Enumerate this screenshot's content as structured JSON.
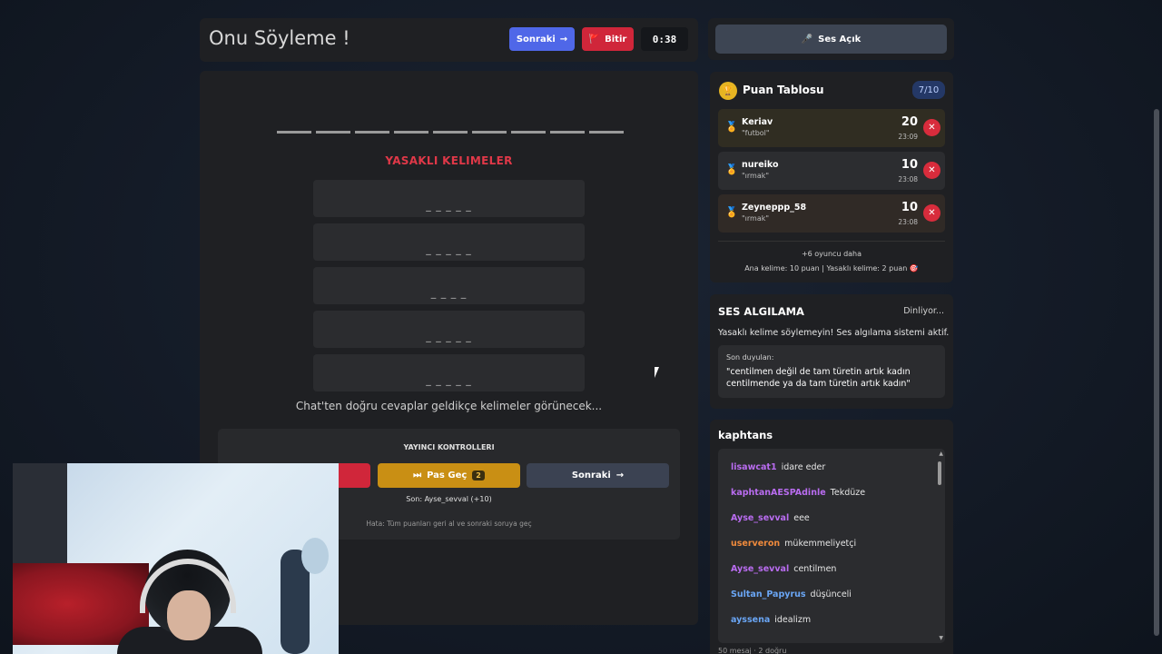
{
  "game": {
    "title": "Onu Söyleme !",
    "next_label": "Sonraki",
    "next_arrow": "→",
    "finish_label": "Bitir",
    "finish_icon": "🚩",
    "timer": "0:38"
  },
  "board": {
    "forbidden_title": "YASAKLI KELIMELER",
    "forbidden_words": [
      "_ _ _ _ _",
      "_ _ _ _ _",
      "_ _ _ _",
      "_ _ _ _ _",
      "_ _ _ _ _"
    ],
    "hint": "Chat'ten doğru cevaplar geldikçe kelimeler görünecek..."
  },
  "controls": {
    "title": "YAYINCI KONTROLLERI",
    "pass_label": "Pas Geç",
    "pass_icon": "⏭",
    "pass_count": "2",
    "next_label": "Sonraki",
    "next_arrow": "→",
    "last": "Son: Ayse_sevval (+10)",
    "error_hint": "Hata: Tüm puanları geri al ve sonraki soruya geç"
  },
  "sound": {
    "label": "Ses Açık",
    "icon": "🎤"
  },
  "scoreboard": {
    "title": "Puan Tablosu",
    "count": "7/10",
    "players": [
      {
        "name": "Keriav",
        "word": "\"futbol\"",
        "score": "20",
        "time": "23:09"
      },
      {
        "name": "nureiko",
        "word": "\"ırmak\"",
        "score": "10",
        "time": "23:08"
      },
      {
        "name": "Zeyneppp_58",
        "word": "\"ırmak\"",
        "score": "10",
        "time": "23:08"
      }
    ],
    "more": "+6 oyuncu daha",
    "points_info": "Ana kelime: 10 puan | Yasaklı kelime: 2 puan 🎯"
  },
  "voice": {
    "title": "SES ALGILAMA",
    "status": "Dinliyor...",
    "desc": "Yasaklı kelime söylemeyin! Ses algılama sistemi aktif.",
    "heard_label": "Son duyulan:",
    "heard_text": "\"centilmen değil de tam türetin artık kadın centilmende ya da tam türetin artık kadın\""
  },
  "chat": {
    "title": "kaphtans",
    "messages": [
      {
        "user": "lisawcat1",
        "text": "idare eder",
        "color": "#b96cf0"
      },
      {
        "user": "kaphtanAESPAdinle",
        "text": "Tekdüze",
        "color": "#b96cf0"
      },
      {
        "user": "Ayse_sevval",
        "text": "eee",
        "color": "#b96cf0"
      },
      {
        "user": "userveron",
        "text": "mükemmeliyetçi",
        "color": "#f08a3c"
      },
      {
        "user": "Ayse_sevval",
        "text": "centilmen",
        "color": "#b96cf0"
      },
      {
        "user": "Sultan_Papyrus",
        "text": "düşünceli",
        "color": "#6aa6f5"
      },
      {
        "user": "ayssena",
        "text": "idealizm",
        "color": "#6aa6f5"
      }
    ],
    "footer": "50 mesaj · 2 doğru"
  }
}
